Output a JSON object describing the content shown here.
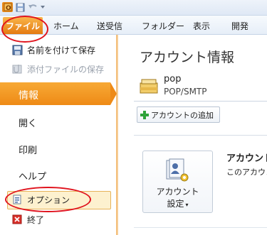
{
  "ribbon": {
    "tabs": [
      "ファイル",
      "ホーム",
      "送受信",
      "フォルダー",
      "表示",
      "開発"
    ]
  },
  "left_menu": {
    "save_as": "名前を付けて保存",
    "save_attachments": "添付ファイルの保存",
    "info": "情報",
    "open": "開く",
    "print": "印刷",
    "help": "ヘルプ",
    "options": "オプション",
    "exit": "終了"
  },
  "main": {
    "title": "アカウント情報",
    "account_name": "pop",
    "account_type": "POP/SMTP",
    "add_account": "アカウントの追加",
    "settings_button_line1": "アカウント",
    "settings_button_line2": "設定",
    "settings_heading": "アカウント",
    "settings_desc": "このアカウン"
  },
  "colors": {
    "accent": "#ee8a16",
    "highlight_oval": "#e0141e"
  }
}
